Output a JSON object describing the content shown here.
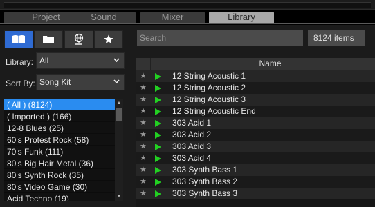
{
  "tabs": [
    {
      "label": "Project",
      "active": false
    },
    {
      "label": "Sound",
      "active": false
    },
    {
      "label": "Mixer",
      "active": false
    },
    {
      "label": "Library",
      "active": true
    }
  ],
  "icons": {
    "browse": "book-icon",
    "folder": "folder-icon",
    "web": "globe-icon",
    "favorites": "star-icon",
    "active_color": "#2f6bd3"
  },
  "library": {
    "label": "Library:",
    "value": "All"
  },
  "sort": {
    "label": "Sort By:",
    "value": "Song Kit"
  },
  "library_list": [
    "( All ) (8124)",
    "( Imported ) (166)",
    "12-8 Blues (25)",
    "60's Protest Rock (58)",
    "70's Funk (111)",
    "80's Big Hair Metal (36)",
    "80's Synth Rock (35)",
    "80's Video Game (30)",
    "Acid Techno (19)"
  ],
  "search": {
    "placeholder": "Search",
    "count": "8124 items"
  },
  "table": {
    "header": "Name",
    "rows": [
      "12 String Acoustic 1",
      "12 String Acoustic 2",
      "12 String Acoustic 3",
      "12 String Acoustic End",
      "303 Acid 1",
      "303 Acid 2",
      "303 Acid 3",
      "303 Acid 4",
      "303 Synth Bass 1",
      "303 Synth Bass 2",
      "303 Synth Bass 3"
    ],
    "play_color": "#22d022"
  }
}
